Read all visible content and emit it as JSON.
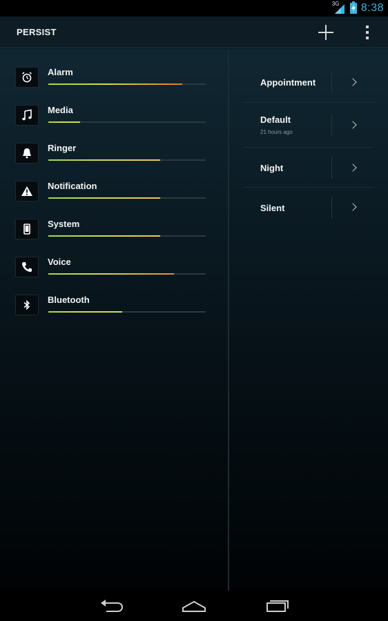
{
  "status_bar": {
    "network_label": "3G",
    "time": "8:38",
    "icons": [
      "signal-icon",
      "battery-charging-icon"
    ]
  },
  "action_bar": {
    "title": "PERSIST",
    "actions": [
      "add-icon",
      "overflow-menu-icon"
    ]
  },
  "streams": [
    {
      "name": "Alarm",
      "icon": "alarm-clock-icon",
      "level": 0.85,
      "color": "#e07a2e"
    },
    {
      "name": "Media",
      "icon": "music-note-icon",
      "level": 0.2,
      "color": "#c8e05a"
    },
    {
      "name": "Ringer",
      "icon": "bell-icon",
      "level": 0.71,
      "color": "#e8c95a"
    },
    {
      "name": "Notification",
      "icon": "warning-icon",
      "level": 0.71,
      "color": "#e8c95a"
    },
    {
      "name": "System",
      "icon": "phone-device-icon",
      "level": 0.71,
      "color": "#e8c95a"
    },
    {
      "name": "Voice",
      "icon": "phone-call-icon",
      "level": 0.8,
      "color": "#e0902e"
    },
    {
      "name": "Bluetooth",
      "icon": "bluetooth-icon",
      "level": 0.47,
      "color": "#c8e05a"
    }
  ],
  "profiles": [
    {
      "name": "Appointment",
      "subtitle": ""
    },
    {
      "name": "Default",
      "subtitle": "21 hours ago"
    },
    {
      "name": "Night",
      "subtitle": ""
    },
    {
      "name": "Silent",
      "subtitle": ""
    }
  ],
  "nav_bar": {
    "buttons": [
      "back-icon",
      "home-icon",
      "recent-apps-icon"
    ]
  },
  "colors": {
    "accent": "#33b5e5",
    "track": "#2b3a40"
  }
}
